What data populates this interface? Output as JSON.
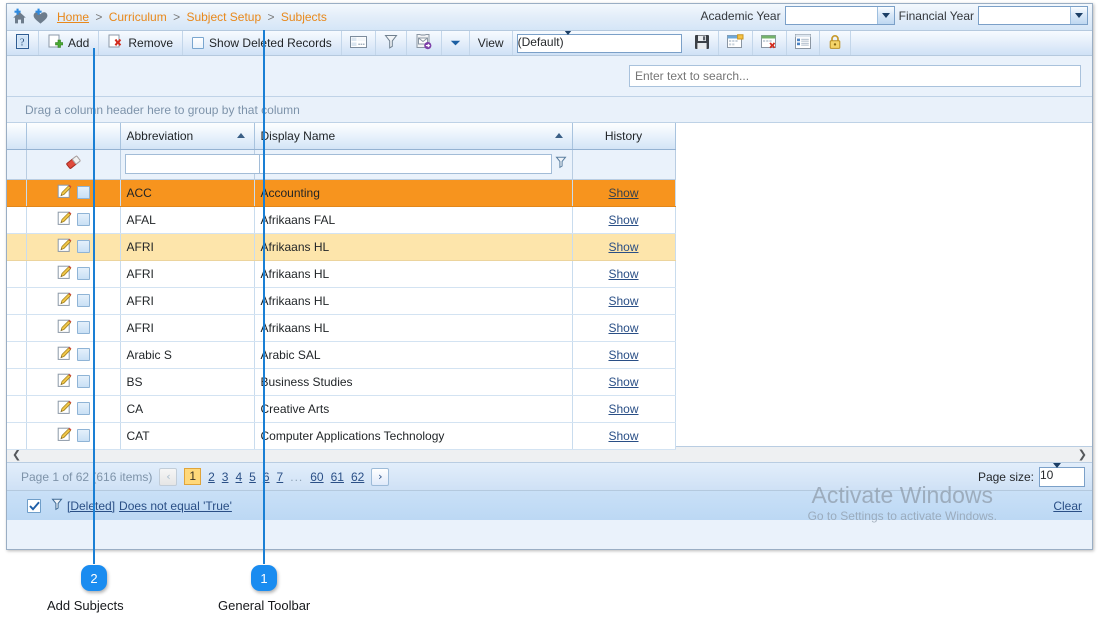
{
  "breadcrumb": {
    "items": [
      {
        "label": "Home",
        "link": true
      },
      {
        "label": "Curriculum",
        "link": false
      },
      {
        "label": "Subject Setup",
        "link": false
      },
      {
        "label": "Subjects",
        "link": false
      }
    ],
    "separator": ">"
  },
  "year_selectors": {
    "academic_label": "Academic Year",
    "academic_value": "",
    "financial_label": "Financial Year",
    "financial_value": ""
  },
  "toolbar": {
    "help_icon": "help-icon",
    "add_label": "Add",
    "remove_label": "Remove",
    "show_deleted_label": "Show Deleted Records",
    "layout_icon": "column-chooser-icon",
    "filter_icon": "filter-funnel-icon",
    "export_icon": "export-email-icon",
    "dropdown_icon": "chevron-down-icon",
    "view_label": "View",
    "view_value": "(Default)",
    "save_icon": "save-icon",
    "save_as_icon": "save-view-as-icon",
    "delete_view_icon": "delete-view-icon",
    "grid_settings_icon": "grid-settings-icon",
    "lock_icon": "lock-icon"
  },
  "search": {
    "placeholder": "Enter text to search...",
    "value": ""
  },
  "group_panel": {
    "hint": "Drag a column header here to group by that column"
  },
  "grid": {
    "columns": [
      {
        "key": "indicator",
        "label": "",
        "sorted": null
      },
      {
        "key": "actions",
        "label": "",
        "sorted": null
      },
      {
        "key": "abbreviation",
        "label": "Abbreviation",
        "sorted": "asc"
      },
      {
        "key": "display_name",
        "label": "Display Name",
        "sorted": "asc"
      },
      {
        "key": "history",
        "label": "History",
        "sorted": null
      }
    ],
    "filter_row": {
      "clear_icon": "eraser-icon",
      "abbreviation_value": "",
      "display_name_value": "",
      "funnel_icon": "filter-funnel-icon"
    },
    "history_link_label": "Show",
    "edit_icon": "edit-pencil-icon",
    "rows": [
      {
        "abbreviation": "ACC",
        "display_name": "Accounting",
        "state": "selected"
      },
      {
        "abbreviation": "AFAL",
        "display_name": "Afrikaans FAL",
        "state": "normal"
      },
      {
        "abbreviation": "AFRI",
        "display_name": "Afrikaans HL",
        "state": "hover"
      },
      {
        "abbreviation": "AFRI",
        "display_name": "Afrikaans HL",
        "state": "normal"
      },
      {
        "abbreviation": "AFRI",
        "display_name": "Afrikaans HL",
        "state": "normal"
      },
      {
        "abbreviation": "AFRI",
        "display_name": "Afrikaans HL",
        "state": "normal"
      },
      {
        "abbreviation": "Arabic S",
        "display_name": "Arabic SAL",
        "state": "normal"
      },
      {
        "abbreviation": "BS",
        "display_name": "Business Studies",
        "state": "normal"
      },
      {
        "abbreviation": "CA",
        "display_name": "Creative Arts",
        "state": "normal"
      },
      {
        "abbreviation": "CAT",
        "display_name": "Computer Applications Technology",
        "state": "normal"
      }
    ]
  },
  "hscroll": {
    "left_arrow": "chevron-left-icon",
    "right_arrow": "chevron-right-icon"
  },
  "pager": {
    "info": "Page 1 of 62 (616 items)",
    "prev_label": "‹",
    "next_label": "›",
    "pages": [
      "1",
      "2",
      "3",
      "4",
      "5",
      "6",
      "7"
    ],
    "ellipsis": "...",
    "tail_pages": [
      "60",
      "61",
      "62"
    ],
    "current_page": "1",
    "page_size_label": "Page size:",
    "page_size_value": "10"
  },
  "filter_bar": {
    "checkbox_checked": true,
    "filter_icon": "filter-funnel-icon",
    "expression_field": "[Deleted]",
    "expression_rest": "Does not equal 'True'",
    "clear_label": "Clear"
  },
  "watermark": {
    "line1": "Activate Windows",
    "line2": "Go to Settings to activate Windows."
  },
  "callouts": [
    {
      "number": "1",
      "label": "General Toolbar"
    },
    {
      "number": "2",
      "label": "Add Subjects"
    }
  ],
  "colors": {
    "accent_orange": "#f7941e",
    "hover_yellow": "#fde5ab",
    "link_blue": "#2a4f86",
    "breadcrumb_orange": "#e8881a",
    "callout_blue": "#1a8cf0"
  }
}
